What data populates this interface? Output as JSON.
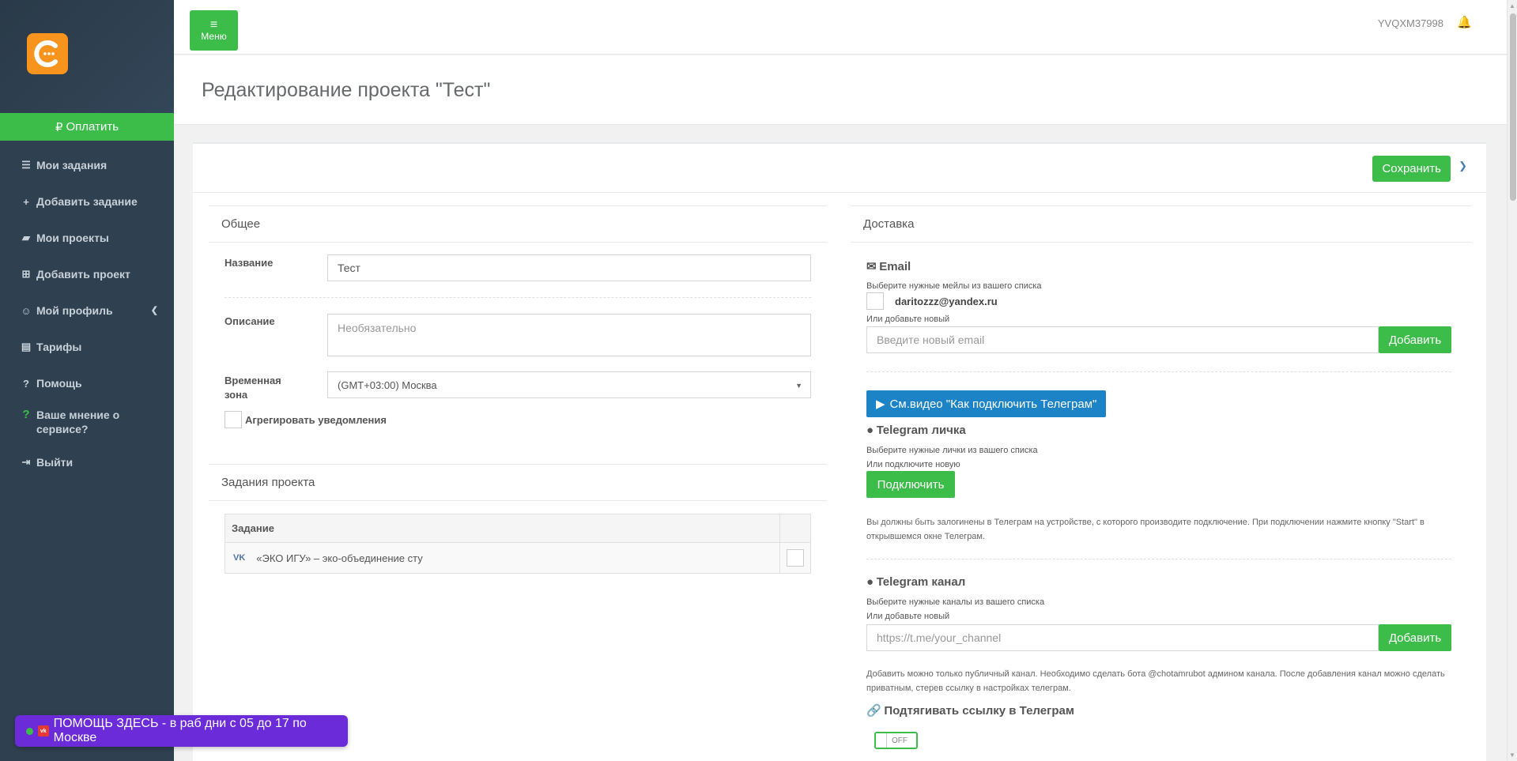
{
  "sidebar": {
    "pay_label": "Оплатить",
    "items": [
      {
        "icon": "list-icon",
        "glyph": "☰",
        "label": "Мои задания"
      },
      {
        "icon": "plus-icon",
        "glyph": "+",
        "label": "Добавить задание"
      },
      {
        "icon": "briefcase-icon",
        "glyph": "▰",
        "label": "Мои проекты"
      },
      {
        "icon": "plus-square-icon",
        "glyph": "⊞",
        "label": "Добавить проект"
      },
      {
        "icon": "user-icon",
        "glyph": "☺",
        "label": "Мой профиль"
      },
      {
        "icon": "table-icon",
        "glyph": "▤",
        "label": "Тарифы"
      },
      {
        "icon": "help-circle-icon",
        "glyph": "?",
        "label": "Помощь"
      },
      {
        "icon": "question-icon",
        "glyph": "?",
        "label": "Ваше мнение о сервисе?"
      },
      {
        "icon": "sign-out-icon",
        "glyph": "⇥",
        "label": "Выйти"
      }
    ]
  },
  "topbar": {
    "menu_label": "Меню",
    "user_id": "YVQXM37998"
  },
  "page": {
    "title": "Редактирование проекта \"Тест\""
  },
  "card": {
    "save_label": "Сохранить"
  },
  "general": {
    "heading": "Общее",
    "name_label": "Название",
    "name_value": "Тест",
    "description_label": "Описание",
    "description_placeholder": "Необязательно",
    "timezone_label": "Временная зона",
    "timezone_value": "(GMT+03:00) Москва",
    "aggregate_label": "Агрегировать уведомления"
  },
  "tasks": {
    "heading": "Задания проекта",
    "column": "Задание",
    "rows": [
      {
        "source": "VK",
        "name": "«ЭКО ИГУ» – эко-объединение сту"
      }
    ]
  },
  "delivery": {
    "heading": "Доставка",
    "email": {
      "title": "Email",
      "hint": "Выберите нужные мейлы из вашего списка",
      "existing": "daritozzz@yandex.ru",
      "or_add": "Или добавьте новый",
      "placeholder": "Введите новый email",
      "add_label": "Добавить"
    },
    "video_button": "См.видео \"Как подключить Телеграм\"",
    "telegram_personal": {
      "title": "Telegram личка",
      "hint": "Выберите нужные лички из вашего списка",
      "or_connect": "Или подключите новую",
      "connect_label": "Подключить",
      "note": "Вы должны быть залогинены в Телеграм на устройстве, с которого производите подключение. При подключении нажмите кнопку \"Start\" в открывшемся окне Телеграм."
    },
    "telegram_channel": {
      "title": "Telegram канал",
      "hint": "Выберите нужные каналы из вашего списка",
      "or_add": "Или добавьте новый",
      "placeholder": "https://t.me/your_channel",
      "add_label": "Добавить",
      "note": "Добавить можно только публичный канал. Необходимо сделать бота @chotamrubot админом канала. После добавления канал можно сделать приватным, стерев ссылку в настройках телеграм."
    },
    "link_pull": {
      "title": "Подтягивать ссылку в Телеграм",
      "toggle_label": "OFF"
    }
  },
  "help_badge": {
    "label": "ПОМОЩЬ ЗДЕСЬ - в раб дни с 05 до 17 по Москве"
  },
  "colors": {
    "sidebar_bg": "#2f4050",
    "accent_green": "#3cbd4a",
    "accent_blue": "#1c84c6",
    "logo_orange": "#f7941d",
    "help_purple": "#6b2bd9"
  }
}
